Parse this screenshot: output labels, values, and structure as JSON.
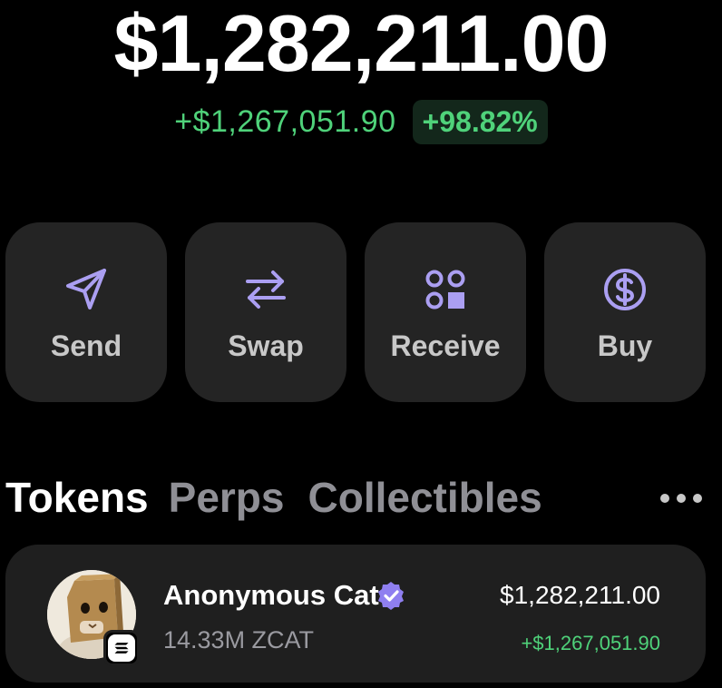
{
  "wallet": {
    "balance": "$1,282,211.00",
    "change_amount": "+$1,267,051.90",
    "change_percent": "+98.82%"
  },
  "actions": [
    {
      "label": "Send",
      "icon": "send-icon"
    },
    {
      "label": "Swap",
      "icon": "swap-icon"
    },
    {
      "label": "Receive",
      "icon": "receive-icon"
    },
    {
      "label": "Buy",
      "icon": "dollar-icon"
    }
  ],
  "tabs": [
    {
      "label": "Tokens",
      "active": true
    },
    {
      "label": "Perps",
      "active": false
    },
    {
      "label": "Collectibles",
      "active": false
    }
  ],
  "tokens": [
    {
      "name": "Anonymous Cat",
      "amount": "14.33M ZCAT",
      "value": "$1,282,211.00",
      "change": "+$1,267,051.90",
      "verified": true,
      "chain_icon": "solana-icon"
    }
  ],
  "colors": {
    "accent": "#ab9ff2",
    "positive": "#4fd27a",
    "card": "#242424",
    "background": "#000000"
  }
}
